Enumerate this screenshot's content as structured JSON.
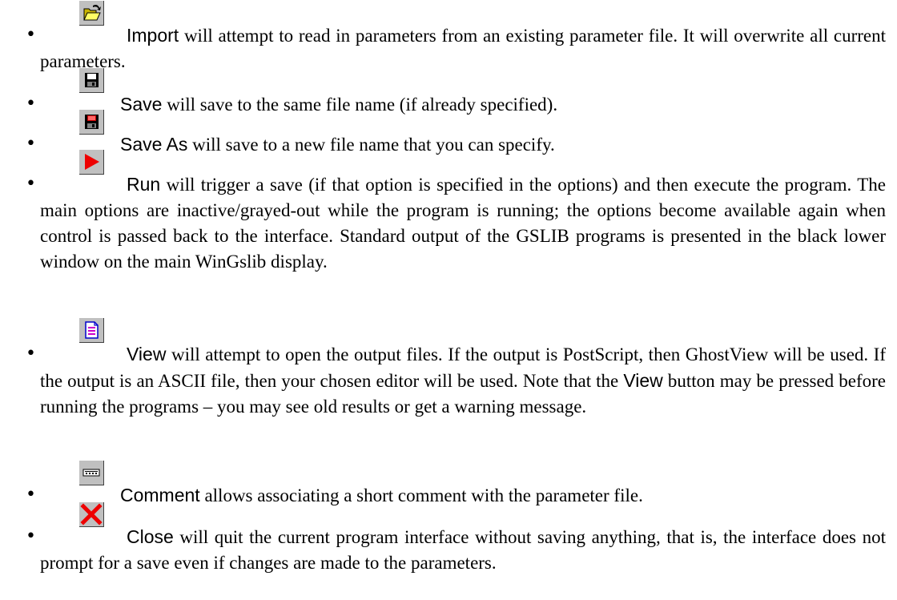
{
  "items": [
    {
      "keyword": "Import",
      "text": " will attempt to read in parameters from an existing parameter file.  It will overwrite all current parameters.",
      "icon": "open-folder-icon"
    },
    {
      "keyword": "Save",
      "text": " will save to the same file name (if already specified).",
      "icon": "floppy-disk-icon"
    },
    {
      "keyword": "Save As",
      "text": " will save to a new file name that you can specify.",
      "icon": "floppy-disk-save-as-icon"
    },
    {
      "keyword": "Run",
      "text": " will trigger a save (if that option is specified in the options) and then execute the program.  The main options are inactive/grayed-out while the program is running; the options become available again when control is passed back to the interface.  Standard output of the GSLIB programs is presented in the black lower window on the main WinGslib display.",
      "icon": "play-triangle-icon"
    },
    {
      "keyword": "View",
      "text_before": " will attempt to open the output files.  If the output is PostScript, then GhostView will be used.  If the output is an ASCII file, then your chosen editor will be used.  Note that the ",
      "inline_keyword": "View",
      "text_after": " button may be pressed before running the programs – you may see old results or get a warning message.",
      "icon": "document-view-icon"
    },
    {
      "keyword": "Comment",
      "text": " allows associating a short comment with the parameter file.",
      "icon": "comment-field-icon"
    },
    {
      "keyword": "Close",
      "text": " will quit the current program interface without saving anything, that is, the interface does not prompt for a save even if changes are made to the parameters.",
      "icon": "close-x-icon"
    }
  ],
  "bullet": "•"
}
